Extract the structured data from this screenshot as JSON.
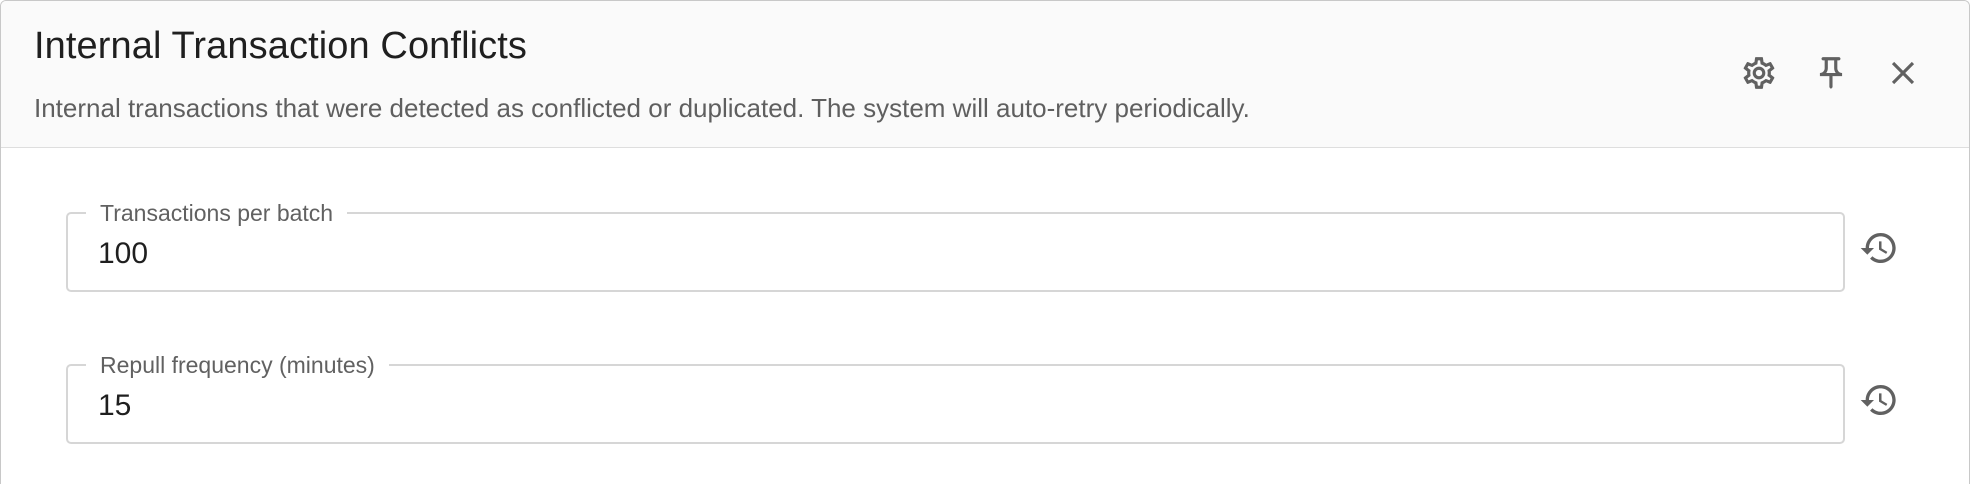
{
  "dialog": {
    "title": "Internal Transaction Conflicts",
    "subtitle": "Internal transactions that were detected as conflicted or duplicated. The system will auto-retry periodically.",
    "actions": [
      {
        "name": "settings",
        "icon": "gear-icon"
      },
      {
        "name": "pin",
        "icon": "pin-icon"
      },
      {
        "name": "close",
        "icon": "close-icon"
      }
    ]
  },
  "fields": [
    {
      "label": "Transactions per batch",
      "value": "100",
      "reset_icon": "history-icon"
    },
    {
      "label": "Repull frequency (minutes)",
      "value": "15",
      "reset_icon": "history-icon"
    }
  ],
  "colors": {
    "header_bg": "#fafafa",
    "border": "#d6d6d6",
    "icon": "#616161",
    "text_primary": "#1f1f1f",
    "text_secondary": "#5f5f5f"
  }
}
